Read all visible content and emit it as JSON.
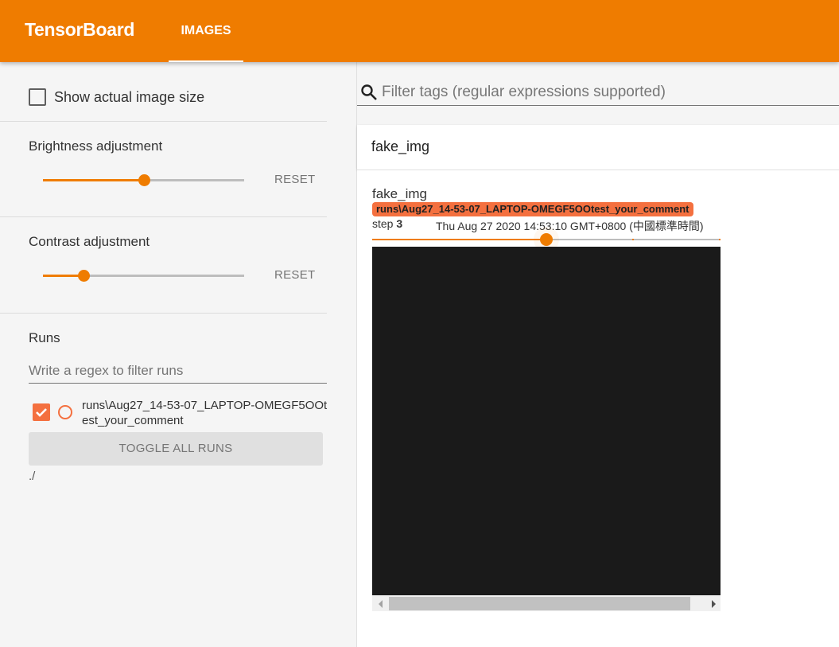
{
  "header": {
    "brand": "TensorBoard",
    "tabs": [
      {
        "label": "IMAGES",
        "active": true
      }
    ],
    "color": "#ef7c00"
  },
  "sidebar": {
    "show_actual_size": {
      "label": "Show actual image size",
      "checked": false
    },
    "brightness": {
      "title": "Brightness adjustment",
      "value_fraction": 0.5,
      "reset_label": "RESET"
    },
    "contrast": {
      "title": "Contrast adjustment",
      "value_fraction": 0.2,
      "reset_label": "RESET"
    },
    "runs": {
      "title": "Runs",
      "filter_placeholder": "Write a regex to filter runs",
      "filter_value": "",
      "items": [
        {
          "name": "runs\\Aug27_14-53-07_LAPTOP-OMEGF5OOtest_your_comment",
          "checked": true,
          "color": "#f4703f"
        }
      ],
      "toggle_all_label": "TOGGLE ALL RUNS",
      "logdir": "./"
    }
  },
  "main": {
    "tag_filter": {
      "icon": "search-icon",
      "placeholder": "Filter tags (regular expressions supported)",
      "value": ""
    },
    "category": {
      "name": "fake_img"
    },
    "card": {
      "tag": "fake_img",
      "run": "runs\\Aug27_14-53-07_LAPTOP-OMEGF5OOtest_your_comment",
      "step_label": "step",
      "step": "3",
      "wall_time": "Thu Aug 27 2020 14:53:10 GMT+0800 (中國標準時間)",
      "step_slider_fraction": 0.5,
      "step_ticks_fraction": [
        0.75,
        1.0
      ],
      "image_color": "#1a1a1a",
      "hscroll_fraction": 0.87
    }
  }
}
